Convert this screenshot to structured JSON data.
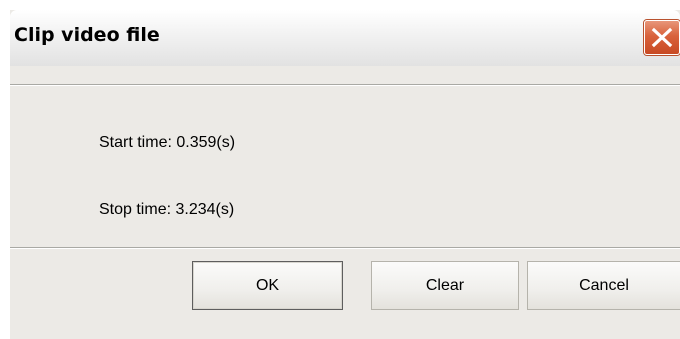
{
  "dialog": {
    "title": "Clip video file",
    "close_icon": "close-icon"
  },
  "fields": {
    "start_time": "Start time: 0.359(s)",
    "stop_time": "Stop time: 3.234(s)"
  },
  "buttons": {
    "ok_label": "OK",
    "clear_label": "Clear",
    "cancel_label": "Cancel"
  },
  "colors": {
    "close_button": "#d9623c",
    "dialog_background": "#eceae6"
  }
}
